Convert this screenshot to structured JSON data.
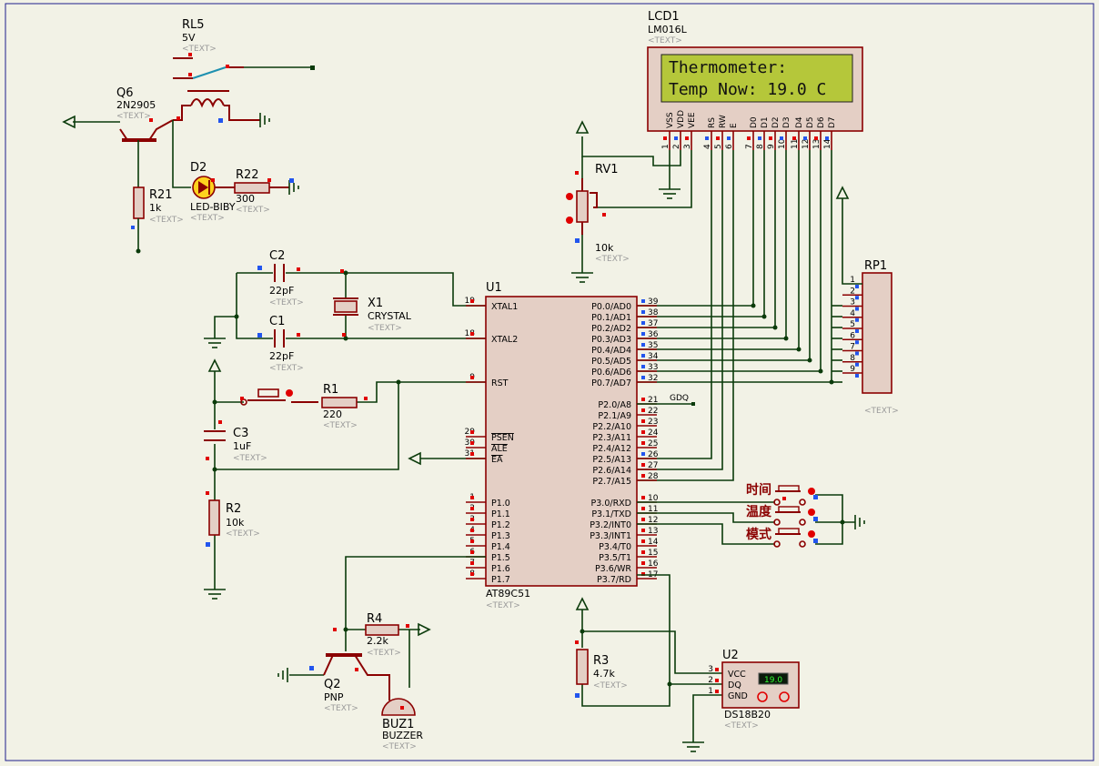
{
  "lcd": {
    "ref": "LCD1",
    "part": "LM016L",
    "line1": "Thermometer:",
    "line2": "Temp Now: 19.0 C",
    "pins": [
      "VSS",
      "VDD",
      "VEE",
      "RS",
      "RW",
      "E",
      "D0",
      "D1",
      "D2",
      "D3",
      "D4",
      "D5",
      "D6",
      "D7"
    ],
    "pin_numbers": [
      "1",
      "2",
      "3",
      "4",
      "5",
      "6",
      "7",
      "8",
      "9",
      "10",
      "11",
      "12",
      "13",
      "14"
    ]
  },
  "relay": {
    "ref": "RL5",
    "value": "5V"
  },
  "q6": {
    "ref": "Q6",
    "part": "2N2905"
  },
  "d2": {
    "ref": "D2",
    "part": "LED-BIBY"
  },
  "r22": {
    "ref": "R22",
    "value": "300"
  },
  "r21": {
    "ref": "R21",
    "value": "1k"
  },
  "rv1": {
    "ref": "RV1",
    "value": "10k"
  },
  "rp1": {
    "ref": "RP1",
    "pins": [
      "1",
      "2",
      "3",
      "4",
      "5",
      "6",
      "7",
      "8",
      "9"
    ]
  },
  "c2": {
    "ref": "C2",
    "value": "22pF"
  },
  "c1": {
    "ref": "C1",
    "value": "22pF"
  },
  "x1": {
    "ref": "X1",
    "part": "CRYSTAL"
  },
  "r1": {
    "ref": "R1",
    "value": "220"
  },
  "c3": {
    "ref": "C3",
    "value": "1uF"
  },
  "r2": {
    "ref": "R2",
    "value": "10k"
  },
  "r4": {
    "ref": "R4",
    "value": "2.2k"
  },
  "q2": {
    "ref": "Q2",
    "part": "PNP"
  },
  "buz": {
    "ref": "BUZ1",
    "part": "BUZZER"
  },
  "r3": {
    "ref": "R3",
    "value": "4.7k"
  },
  "u2": {
    "ref": "U2",
    "part": "DS18B20",
    "display": "19.0",
    "pins": [
      "VCC",
      "DQ",
      "GND"
    ],
    "pin_numbers": [
      "3",
      "2",
      "1"
    ]
  },
  "u1": {
    "ref": "U1",
    "part": "AT89C51",
    "left_pins": [
      {
        "num": "19",
        "name": "XTAL1"
      },
      {
        "num": "18",
        "name": "XTAL2"
      },
      {
        "num": "9",
        "name": "RST"
      },
      {
        "num": "29",
        "name": "PSEN"
      },
      {
        "num": "30",
        "name": "ALE"
      },
      {
        "num": "31",
        "name": "EA"
      },
      {
        "num": "1",
        "name": "P1.0"
      },
      {
        "num": "2",
        "name": "P1.1"
      },
      {
        "num": "3",
        "name": "P1.2"
      },
      {
        "num": "4",
        "name": "P1.3"
      },
      {
        "num": "5",
        "name": "P1.4"
      },
      {
        "num": "6",
        "name": "P1.5"
      },
      {
        "num": "7",
        "name": "P1.6"
      },
      {
        "num": "8",
        "name": "P1.7"
      }
    ],
    "right_pins": [
      {
        "num": "39",
        "name": "P0.0/AD0"
      },
      {
        "num": "38",
        "name": "P0.1/AD1"
      },
      {
        "num": "37",
        "name": "P0.2/AD2"
      },
      {
        "num": "36",
        "name": "P0.3/AD3"
      },
      {
        "num": "35",
        "name": "P0.4/AD4"
      },
      {
        "num": "34",
        "name": "P0.5/AD5"
      },
      {
        "num": "33",
        "name": "P0.6/AD6"
      },
      {
        "num": "32",
        "name": "P0.7/AD7"
      },
      {
        "num": "21",
        "name": "P2.0/A8"
      },
      {
        "num": "22",
        "name": "P2.1/A9"
      },
      {
        "num": "23",
        "name": "P2.2/A10"
      },
      {
        "num": "24",
        "name": "P2.3/A11"
      },
      {
        "num": "25",
        "name": "P2.4/A12"
      },
      {
        "num": "26",
        "name": "P2.5/A13"
      },
      {
        "num": "27",
        "name": "P2.6/A14"
      },
      {
        "num": "28",
        "name": "P2.7/A15"
      },
      {
        "num": "10",
        "name": "P3.0/RXD"
      },
      {
        "num": "11",
        "name": "P3.1/TXD"
      },
      {
        "num": "12",
        "name": "P3.2/INT0"
      },
      {
        "num": "13",
        "name": "P3.3/INT1"
      },
      {
        "num": "14",
        "name": "P3.4/T0"
      },
      {
        "num": "15",
        "name": "P3.5/T1"
      },
      {
        "num": "16",
        "name": "P3.6/WR"
      },
      {
        "num": "17",
        "name": "P3.7/RD"
      }
    ]
  },
  "net_gdq": "GDQ",
  "buttons": {
    "time": "时间",
    "temp": "温度",
    "mode": "模式"
  },
  "text_placeholder": "<TEXT>",
  "colors": {
    "wire": "#0b3b0b",
    "component": "#8b0000",
    "lcd_bg": "#b5c73a",
    "background": "#f2f2e6"
  }
}
